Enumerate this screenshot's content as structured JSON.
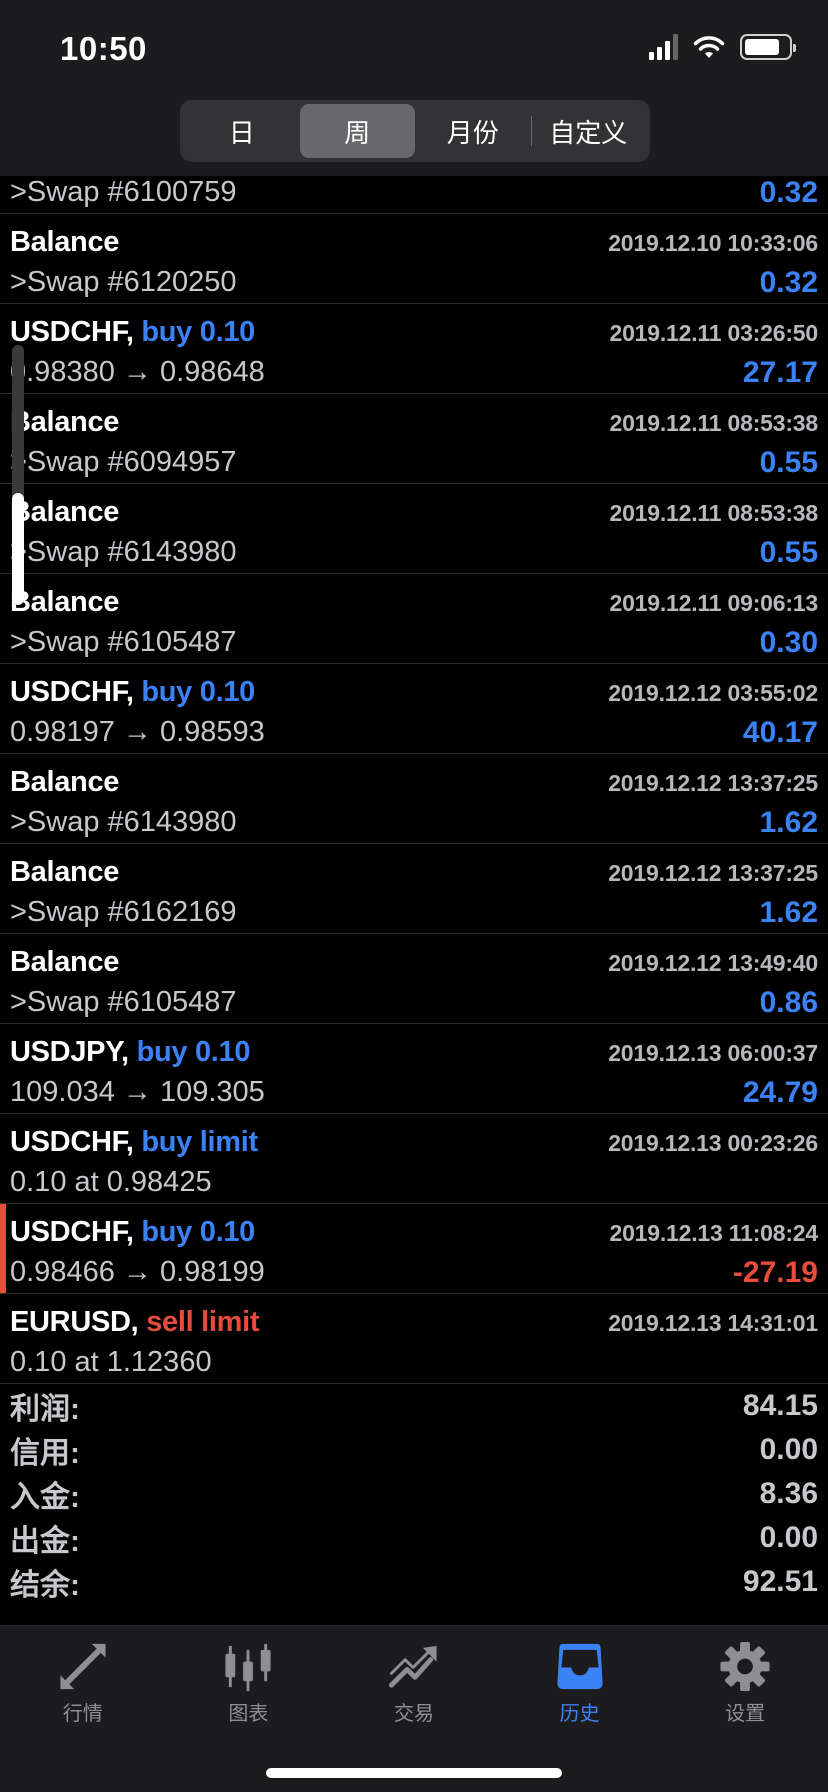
{
  "status": {
    "time": "10:50"
  },
  "segments": [
    {
      "label": "日",
      "active": false
    },
    {
      "label": "周",
      "active": true
    },
    {
      "label": "月份",
      "active": false
    },
    {
      "label": "自定义",
      "active": false
    }
  ],
  "rows": [
    {
      "line2": ">Swap #6100759",
      "amount": "0.32"
    },
    {
      "symbol": "Balance",
      "date": "2019.12.10 10:33:06",
      "line2": ">Swap #6120250",
      "amount": "0.32"
    },
    {
      "symbol": "USDCHF,",
      "action": "buy 0.10",
      "date": "2019.12.11 03:26:50",
      "line2": "0.98380 → 0.98648",
      "amount": "27.17"
    },
    {
      "symbol": "Balance",
      "date": "2019.12.11 08:53:38",
      "line2": ">Swap #6094957",
      "amount": "0.55"
    },
    {
      "symbol": "Balance",
      "date": "2019.12.11 08:53:38",
      "line2": ">Swap #6143980",
      "amount": "0.55"
    },
    {
      "symbol": "Balance",
      "date": "2019.12.11 09:06:13",
      "line2": ">Swap #6105487",
      "amount": "0.30"
    },
    {
      "symbol": "USDCHF,",
      "action": "buy 0.10",
      "date": "2019.12.12 03:55:02",
      "line2": "0.98197 → 0.98593",
      "amount": "40.17"
    },
    {
      "symbol": "Balance",
      "date": "2019.12.12 13:37:25",
      "line2": ">Swap #6143980",
      "amount": "1.62"
    },
    {
      "symbol": "Balance",
      "date": "2019.12.12 13:37:25",
      "line2": ">Swap #6162169",
      "amount": "1.62"
    },
    {
      "symbol": "Balance",
      "date": "2019.12.12 13:49:40",
      "line2": ">Swap #6105487",
      "amount": "0.86"
    },
    {
      "symbol": "USDJPY,",
      "action": "buy 0.10",
      "date": "2019.12.13 06:00:37",
      "line2": "109.034 → 109.305",
      "amount": "24.79"
    },
    {
      "symbol": "USDCHF,",
      "action": "buy limit",
      "date": "2019.12.13 00:23:26",
      "line2": "0.10 at 0.98425",
      "amount": ""
    },
    {
      "symbol": "USDCHF,",
      "action": "buy 0.10",
      "date": "2019.12.13 11:08:24",
      "line2": "0.98466 → 0.98199",
      "amount": "-27.19"
    },
    {
      "symbol": "EURUSD,",
      "action": "sell limit",
      "date": "2019.12.13 14:31:01",
      "line2": "0.10 at 1.12360",
      "amount": ""
    }
  ],
  "summary": [
    {
      "label": "利润:",
      "value": "84.15"
    },
    {
      "label": "信用:",
      "value": "0.00"
    },
    {
      "label": "入金:",
      "value": "8.36"
    },
    {
      "label": "出金:",
      "value": "0.00"
    },
    {
      "label": "结余:",
      "value": "92.51"
    }
  ],
  "tabs": [
    {
      "label": "行情",
      "icon": "quotes-arrows-icon"
    },
    {
      "label": "图表",
      "icon": "candlestick-chart-icon"
    },
    {
      "label": "交易",
      "icon": "trade-trend-icon"
    },
    {
      "label": "历史",
      "icon": "history-inbox-icon"
    },
    {
      "label": "设置",
      "icon": "settings-gear-icon"
    }
  ],
  "colors": {
    "accent": "#3b82f6",
    "negative": "#e74c3c"
  }
}
